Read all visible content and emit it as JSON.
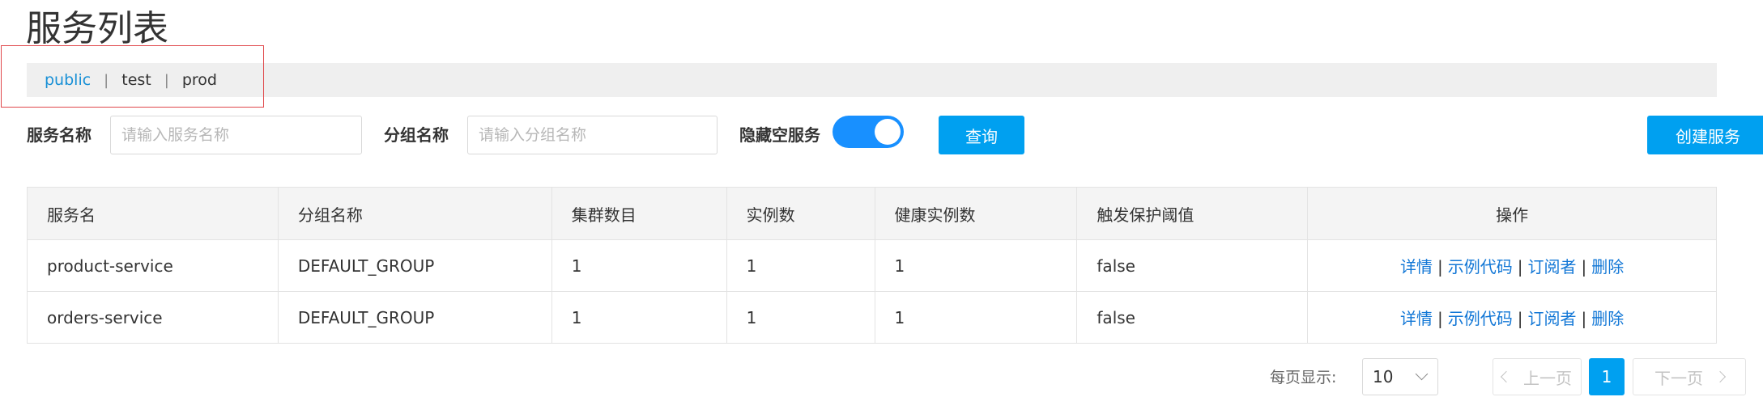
{
  "page": {
    "title": "服务列表"
  },
  "namespaces": [
    {
      "label": "public",
      "active": true
    },
    {
      "label": "test",
      "active": false
    },
    {
      "label": "prod",
      "active": false
    }
  ],
  "namespace_separator": "|",
  "filters": {
    "service_name_label": "服务名称",
    "service_name_placeholder": "请输入服务名称",
    "group_name_label": "分组名称",
    "group_name_placeholder": "请输入分组名称",
    "hide_empty_label": "隐藏空服务",
    "hide_empty_on": true,
    "query_button": "查询",
    "create_button": "创建服务"
  },
  "table": {
    "headers": {
      "service": "服务名",
      "group": "分组名称",
      "clusters": "集群数目",
      "instances": "实例数",
      "healthy": "健康实例数",
      "threshold": "触发保护阈值",
      "ops": "操作"
    },
    "rows": [
      {
        "service": "product-service",
        "group": "DEFAULT_GROUP",
        "clusters": "1",
        "instances": "1",
        "healthy": "1",
        "threshold": "false"
      },
      {
        "service": "orders-service",
        "group": "DEFAULT_GROUP",
        "clusters": "1",
        "instances": "1",
        "healthy": "1",
        "threshold": "false"
      }
    ],
    "ops": {
      "detail": "详情",
      "sample_code": "示例代码",
      "subscribers": "订阅者",
      "delete": "删除",
      "separator": "|"
    }
  },
  "pagination": {
    "per_page_label": "每页显示:",
    "per_page_value": "10",
    "prev_label": "上一页",
    "current_page": "1",
    "next_label": "下一页"
  },
  "colors": {
    "accent": "#00a0f0",
    "link": "#1277d6",
    "highlight_border": "#e0484b"
  }
}
